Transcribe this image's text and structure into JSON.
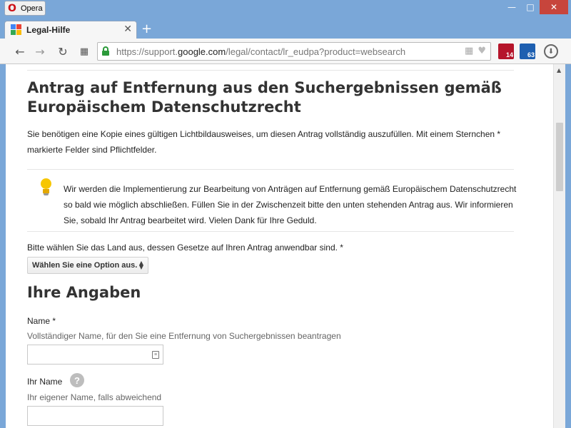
{
  "window": {
    "app_name": "Opera",
    "minimize_glyph": "—",
    "maximize_glyph": "□",
    "close_glyph": "✕"
  },
  "tabs": [
    {
      "title": "Legal-Hilfe",
      "close_glyph": "✕",
      "favicon": "google-favicon"
    }
  ],
  "new_tab_glyph": "+",
  "toolbar": {
    "back_glyph": "←",
    "forward_glyph": "→",
    "reload_glyph": "↻",
    "speeddial_glyph": "▦",
    "url_prefix": "https://support.",
    "url_domain": "google.com",
    "url_path": "/legal/contact/lr_eudpa?product=websearch",
    "addr_icons": [
      "speeddial-icon",
      "heart-icon"
    ],
    "ext1_badge": "14",
    "ext2_badge": "63",
    "download_glyph": "⬇"
  },
  "page": {
    "title": "Antrag auf Entfernung aus den Suchergebnissen gemäß Europäischem Datenschutzrecht",
    "intro": "Sie benötigen eine Kopie eines gültigen Lichtbildausweises, um diesen Antrag vollständig auszufüllen. Mit einem Sternchen * markierte Felder sind Pflichtfelder.",
    "notice": "Wir werden die Implementierung zur Bearbeitung von Anträgen auf Entfernung gemäß Europäischem Datenschutzrecht so bald wie möglich abschließen. Füllen Sie in der Zwischenzeit bitte den unten stehenden Antrag aus. Wir informieren Sie, sobald Ihr Antrag bearbeitet wird. Vielen Dank für Ihre Geduld.",
    "country_label": "Bitte wählen Sie das Land aus, dessen Gesetze auf Ihren Antrag anwendbar sind. *",
    "country_select": "Wählen Sie eine Option aus.",
    "section_heading": "Ihre Angaben",
    "name_label": "Name *",
    "name_hint": "Vollständiger Name, für den Sie eine Entfernung von Suchergebnissen beantragen",
    "name_value": "",
    "your_name_label": "Ihr Name",
    "your_name_hint": "Ihr eigener Name, falls abweichend",
    "your_name_value": "",
    "help_glyph": "?"
  },
  "colors": {
    "window_frame": "#7aa7d8",
    "close_button": "#c7453c",
    "lock_green": "#2c9a3a",
    "bulb_yellow": "#f7c600"
  }
}
